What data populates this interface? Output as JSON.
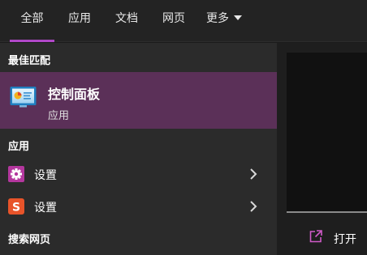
{
  "tabs": {
    "all": "全部",
    "apps": "应用",
    "documents": "文档",
    "web": "网页",
    "more": "更多",
    "active": "all",
    "accent_color": "#b048c8"
  },
  "results": {
    "best_match_label": "最佳匹配",
    "best_match": {
      "title": "控制面板",
      "subtitle": "应用",
      "icon": "control-panel-icon",
      "highlight_color": "#5b3058"
    },
    "apps_label": "应用",
    "apps": [
      {
        "label": "设置",
        "icon": "gear-icon",
        "icon_color": "#c03fb8"
      },
      {
        "label": "设置",
        "icon": "sogou-input-icon",
        "icon_color": "#e8542a"
      }
    ],
    "web_label": "搜索网页"
  },
  "preview": {
    "open_label": "打开",
    "open_icon": "open-external-icon"
  }
}
